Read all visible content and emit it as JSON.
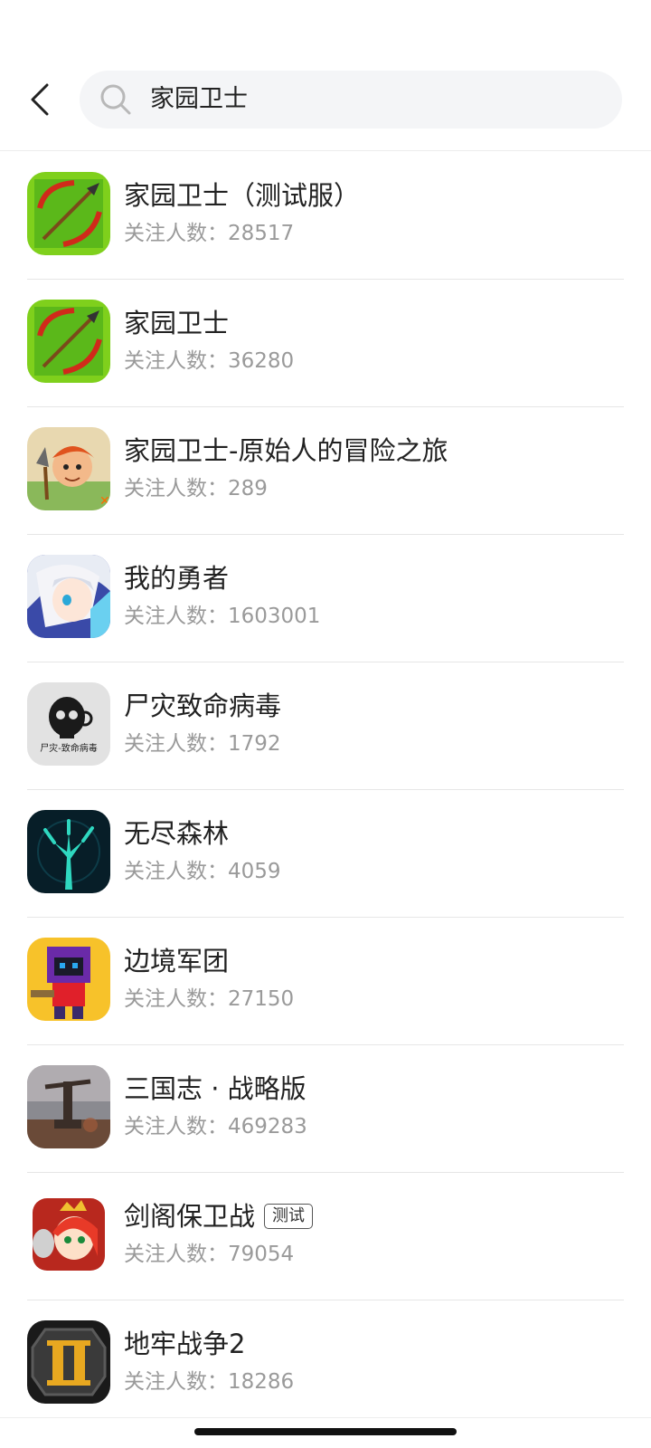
{
  "search": {
    "query": "家园卫士"
  },
  "results": [
    {
      "name": "家园卫士（测试服）",
      "followers": "关注人数：28517",
      "icon": "bow-arrow-icon",
      "tag": ""
    },
    {
      "name": "家园卫士",
      "followers": "关注人数：36280",
      "icon": "bow-arrow-icon",
      "tag": ""
    },
    {
      "name": "家园卫士-原始人的冒险之旅",
      "followers": "关注人数：289",
      "icon": "caveman-icon",
      "tag": ""
    },
    {
      "name": "我的勇者",
      "followers": "关注人数：1603001",
      "icon": "anime-hero-icon",
      "tag": ""
    },
    {
      "name": "尸灾致命病毒",
      "followers": "关注人数：1792",
      "icon": "skull-icon",
      "icon_text": "尸灾-致命病毒",
      "tag": ""
    },
    {
      "name": "无尽森林",
      "followers": "关注人数：4059",
      "icon": "glowing-tree-icon",
      "tag": ""
    },
    {
      "name": "边境军团",
      "followers": "关注人数：27150",
      "icon": "pixel-knight-icon",
      "tag": ""
    },
    {
      "name": "三国志 · 战略版",
      "followers": "关注人数：469283",
      "icon": "siege-battle-icon",
      "tag": ""
    },
    {
      "name": "剑阁保卫战",
      "followers": "关注人数：79054",
      "icon": "warrior-girl-icon",
      "tag": "测试"
    },
    {
      "name": "地牢战争2",
      "followers": "关注人数：18286",
      "icon": "roman-two-icon",
      "tag": ""
    }
  ]
}
